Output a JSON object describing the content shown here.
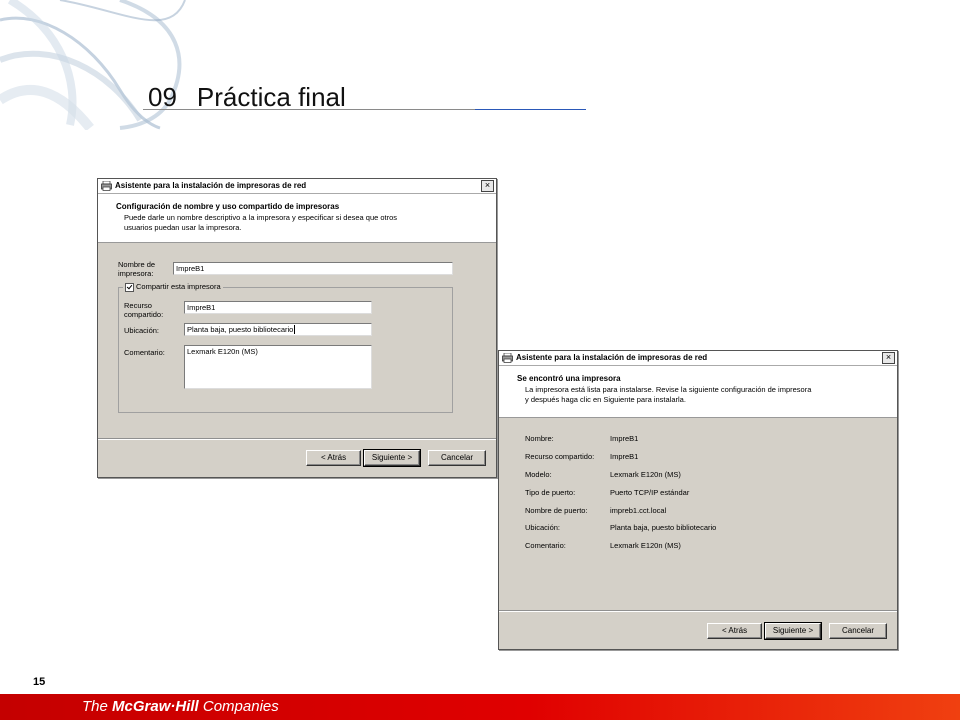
{
  "slide": {
    "number": "09",
    "title": "Práctica final",
    "page": "15"
  },
  "footer": {
    "logo_prefix": "The ",
    "logo_brand": "McGraw·Hill",
    "logo_suffix": " Companies"
  },
  "colors": {
    "footer": "#d40000",
    "title_rule_accent": "#2a58b8",
    "dialog_bg": "#d4d0c8"
  },
  "dialog1": {
    "title": "Asistente para la instalación de impresoras de red",
    "header_title": "Configuración de nombre y uso compartido de impresoras",
    "header_desc_1": "Puede darle un nombre descriptivo a la impresora y especificar si desea que otros",
    "header_desc_2": "usuarios puedan usar la impresora.",
    "name_label_1": "Nombre de",
    "name_label_2": "impresora:",
    "name_value": "ImpreB1",
    "share_label": "Compartir esta impresora",
    "resource_label_1": "Recurso",
    "resource_label_2": "compartido:",
    "resource_value": "ImpreB1",
    "location_label": "Ubicación:",
    "location_value": "Planta baja, puesto bibliotecario",
    "comment_label": "Comentario:",
    "comment_value": "Lexmark E120n (MS)",
    "back_button": "< Atrás",
    "next_button": "Siguiente >",
    "cancel_button": "Cancelar"
  },
  "dialog2": {
    "title": "Asistente para la instalación de impresoras de red",
    "header_title": "Se encontró una impresora",
    "header_desc_1": "La impresora está lista para instalarse. Revise la siguiente configuración de impresora",
    "header_desc_2": "y después haga clic en Siguiente para instalarla.",
    "rows": [
      {
        "label": "Nombre:",
        "value": "ImpreB1"
      },
      {
        "label": "Recurso compartido:",
        "value": "ImpreB1"
      },
      {
        "label": "Modelo:",
        "value": "Lexmark E120n (MS)"
      },
      {
        "label": "Tipo de puerto:",
        "value": "Puerto TCP/IP estándar"
      },
      {
        "label": "Nombre de puerto:",
        "value": "impreb1.cct.local"
      },
      {
        "label": "Ubicación:",
        "value": "Planta baja, puesto bibliotecario"
      },
      {
        "label": "Comentario:",
        "value": "Lexmark E120n (MS)"
      }
    ],
    "back_button": "< Atrás",
    "next_button": "Siguiente >",
    "cancel_button": "Cancelar"
  }
}
